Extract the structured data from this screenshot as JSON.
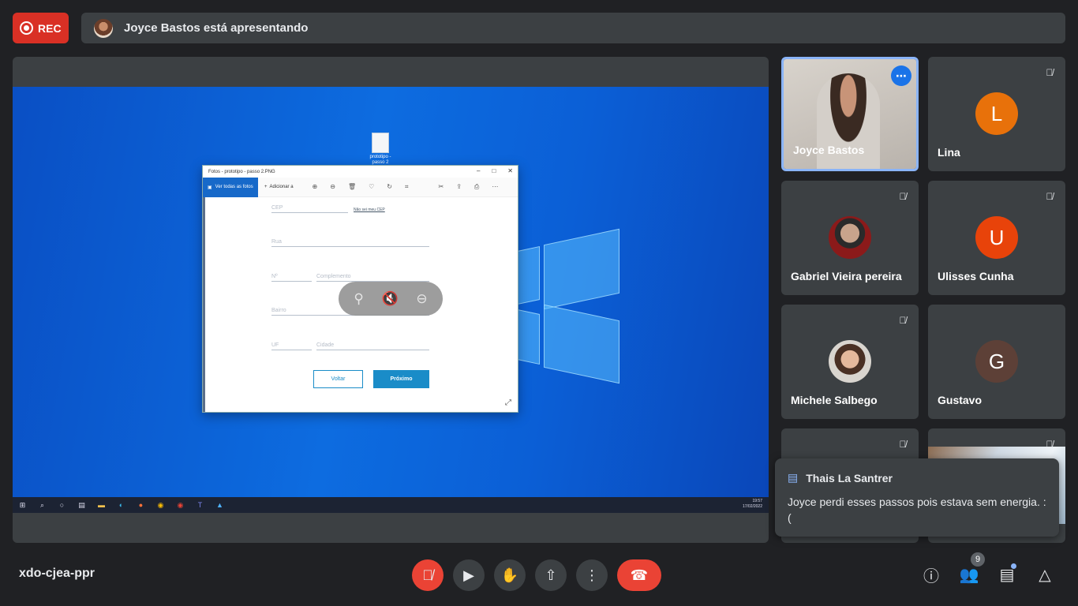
{
  "rec": {
    "label": "REC"
  },
  "presenting": {
    "text": "Joyce Bastos está apresentando"
  },
  "shared_screen": {
    "desktop_icon_label": "prototipo - passo 2",
    "photos_window": {
      "title": "Fotos - prototipo - passo 2.PNG",
      "toolbar_all": "Ver todas as fotos",
      "toolbar_add": "Adicionar a",
      "form": {
        "cep": "CEP",
        "cep_link": "Não sei meu CEP",
        "rua": "Rua",
        "numero": "Nº",
        "complemento": "Complemento",
        "bairro": "Bairro",
        "uf": "UF",
        "cidade": "Cidade",
        "back": "Voltar",
        "next": "Próximo"
      }
    },
    "taskbar_time": "19:57",
    "taskbar_date": "17/02/2022"
  },
  "participants": [
    {
      "name": "Joyce Bastos",
      "type": "video"
    },
    {
      "name": "Lina",
      "letter": "L",
      "color": "#e8710a"
    },
    {
      "name": "Gabriel Vieira pereira",
      "type": "photo"
    },
    {
      "name": "Ulisses Cunha",
      "letter": "U",
      "color": "#e8430a"
    },
    {
      "name": "Michele Salbego",
      "type": "photo"
    },
    {
      "name": "Gustavo",
      "letter": "G",
      "color": "#5d4037"
    }
  ],
  "chat_toast": {
    "sender": "Thais La Santrer",
    "message": "Joyce perdi esses passos pois estava sem energia. :("
  },
  "meeting": {
    "code": "xdo-cjea-ppr"
  },
  "people_count": "9"
}
